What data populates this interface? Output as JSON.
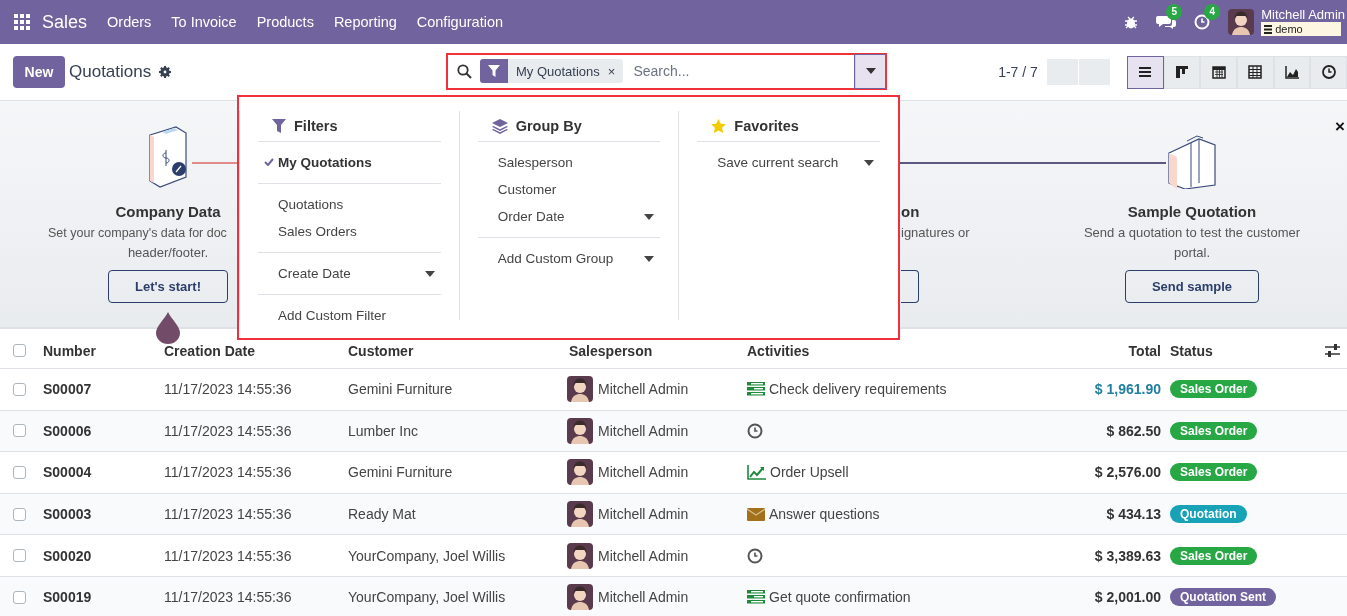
{
  "navbar": {
    "app": "Sales",
    "menu": [
      "Orders",
      "To Invoice",
      "Products",
      "Reporting",
      "Configuration"
    ],
    "messages_count": "5",
    "activities_count": "4",
    "user": "Mitchell Admin",
    "database": "demo"
  },
  "control_panel": {
    "new_button": "New",
    "title": "Quotations",
    "facet": {
      "label": "My Quotations",
      "remove": "×"
    },
    "search_placeholder": "Search...",
    "dropdown_open": true,
    "pager": "1-7 / 7",
    "views": [
      {
        "kind": "list",
        "selected": true
      },
      {
        "kind": "kanban",
        "selected": false
      },
      {
        "kind": "calendar",
        "selected": false
      },
      {
        "kind": "pivot",
        "selected": false
      },
      {
        "kind": "graph",
        "selected": false
      },
      {
        "kind": "activity",
        "selected": false
      }
    ]
  },
  "search_panel": {
    "columns": [
      {
        "kind": "filters",
        "title": "Filters",
        "sections": [
          {
            "items": [
              {
                "label": "My Quotations",
                "checked": true,
                "caret": false
              }
            ]
          },
          {
            "items": [
              {
                "label": "Quotations",
                "checked": false,
                "caret": false
              },
              {
                "label": "Sales Orders",
                "checked": false,
                "caret": false
              }
            ]
          },
          {
            "items": [
              {
                "label": "Create Date",
                "checked": false,
                "caret": true
              }
            ]
          },
          {
            "items": [
              {
                "label": "Add Custom Filter",
                "checked": false,
                "caret": false
              }
            ]
          }
        ]
      },
      {
        "kind": "groupby",
        "title": "Group By",
        "sections": [
          {
            "items": [
              {
                "label": "Salesperson",
                "checked": false,
                "caret": false
              },
              {
                "label": "Customer",
                "checked": false,
                "caret": false
              },
              {
                "label": "Order Date",
                "checked": false,
                "caret": true
              }
            ]
          },
          {
            "items": [
              {
                "label": "Add Custom Group",
                "checked": false,
                "caret": true
              }
            ]
          }
        ]
      },
      {
        "kind": "favorites",
        "title": "Favorites",
        "sections": [
          {
            "items": [
              {
                "label": "Save current search",
                "checked": false,
                "caret": true
              }
            ]
          }
        ]
      }
    ]
  },
  "onboarding": {
    "close": "×",
    "steps": [
      {
        "kind": "company",
        "title": "Company Data",
        "description_lines": [
          "Set your company's data for doc",
          "header/footer."
        ],
        "button": "Let's start!"
      },
      {
        "kind": "signature",
        "title": "on",
        "description_lines": [
          "ignatures or"
        ],
        "has_button": true
      },
      {
        "kind": "sample",
        "title": "Sample Quotation",
        "description_lines": [
          "Send a quotation to test the customer",
          "portal."
        ],
        "button": "Send sample"
      }
    ]
  },
  "table": {
    "select_all": {
      "checked": false
    },
    "columns": [
      "Number",
      "Creation Date",
      "Customer",
      "Salesperson",
      "Activities",
      "Total",
      "Status"
    ],
    "rows": [
      {
        "checked": false,
        "number": "S00007",
        "date": "11/17/2023 14:55:36",
        "customer": "Gemini Furniture",
        "salesperson": "Mitchell Admin",
        "activity": {
          "kind": "todo",
          "text": "Check delivery requirements"
        },
        "total": "$ 1,961.90",
        "total_highlighted": true,
        "status": {
          "label": "Sales Order",
          "color": "#28a745"
        }
      },
      {
        "checked": false,
        "number": "S00006",
        "date": "11/17/2023 14:55:36",
        "customer": "Lumber Inc",
        "salesperson": "Mitchell Admin",
        "activity": {
          "kind": "clock"
        },
        "total": "$ 862.50",
        "total_highlighted": false,
        "status": {
          "label": "Sales Order",
          "color": "#28a745"
        }
      },
      {
        "checked": false,
        "number": "S00004",
        "date": "11/17/2023 14:55:36",
        "customer": "Gemini Furniture",
        "salesperson": "Mitchell Admin",
        "activity": {
          "kind": "upsell",
          "text": "Order Upsell"
        },
        "total": "$ 2,576.00",
        "total_highlighted": false,
        "status": {
          "label": "Sales Order",
          "color": "#28a745"
        }
      },
      {
        "checked": false,
        "number": "S00003",
        "date": "11/17/2023 14:55:36",
        "customer": "Ready Mat",
        "salesperson": "Mitchell Admin",
        "activity": {
          "kind": "email",
          "text": "Answer questions"
        },
        "total": "$ 434.13",
        "total_highlighted": false,
        "status": {
          "label": "Quotation",
          "color": "#17a2b8"
        }
      },
      {
        "checked": false,
        "number": "S00020",
        "date": "11/17/2023 14:55:36",
        "customer": "YourCompany, Joel Willis",
        "salesperson": "Mitchell Admin",
        "activity": {
          "kind": "clock"
        },
        "total": "$ 3,389.63",
        "total_highlighted": false,
        "status": {
          "label": "Sales Order",
          "color": "#28a745"
        }
      },
      {
        "checked": false,
        "number": "S00019",
        "date": "11/17/2023 14:55:36",
        "customer": "YourCompany, Joel Willis",
        "salesperson": "Mitchell Admin",
        "activity": {
          "kind": "todo",
          "text": "Get quote confirmation"
        },
        "total": "$ 2,001.00",
        "total_highlighted": false,
        "status": {
          "label": "Quotation Sent",
          "color": "#71639e"
        }
      }
    ]
  }
}
